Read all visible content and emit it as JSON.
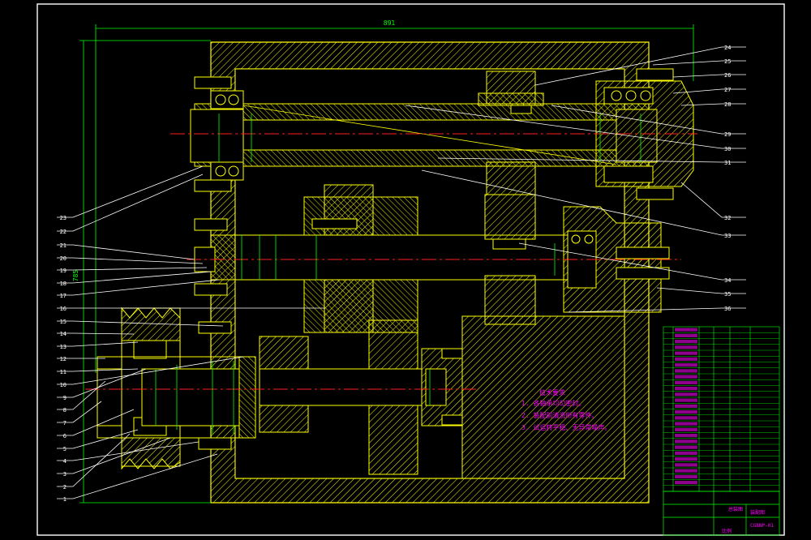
{
  "drawing": {
    "overall_width_dim": "891",
    "overall_height_dim": "785",
    "left_labels": [
      "23",
      "22",
      "21",
      "20",
      "19",
      "18",
      "17",
      "16",
      "15",
      "14",
      "13",
      "12",
      "11",
      "10",
      "9",
      "8",
      "7",
      "6",
      "5",
      "4",
      "3",
      "2",
      "1"
    ],
    "right_labels": [
      "24",
      "25",
      "26",
      "27",
      "28",
      "29",
      "30",
      "31",
      "32",
      "33",
      "34",
      "35",
      "36"
    ],
    "tech_notes": {
      "title": "技术要求",
      "items": [
        "1. 各轴承均匀密封。",
        "2. 装配前清洗所有零件。",
        "3. 试运转平稳、无异常噪声。"
      ]
    }
  },
  "title_block": {
    "drawing_no": "CGBNP-01",
    "label_a": "总装图",
    "label_b": "装配图",
    "label_c": "比例"
  },
  "colors": {
    "frame": "#ffffff",
    "body": "#ffff00",
    "center_line": "#ff2020",
    "dimension": "#00ff00",
    "leader": "#ffffff",
    "text_labels": "#ffffff",
    "notes": "#ff00ff",
    "title_block": "#00ff00"
  }
}
